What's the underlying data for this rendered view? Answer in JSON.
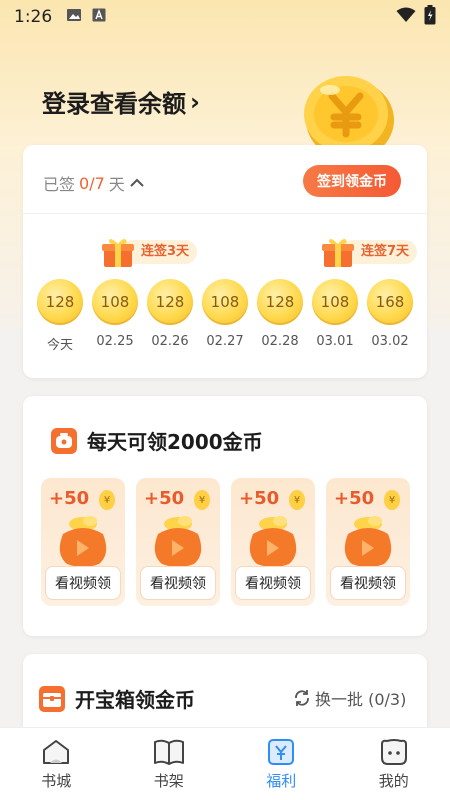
{
  "status_bar": {
    "time": "1:26",
    "icons": [
      "image-icon",
      "a-icon",
      "wifi-icon",
      "battery-icon"
    ]
  },
  "header": {
    "login_text": "登录查看余额",
    "chevron": "›"
  },
  "signin": {
    "signed_prefix": "已签",
    "signed_count": "0/7",
    "signed_suffix": "天",
    "button_label": "签到领金币",
    "badges": [
      {
        "label": "连签3天"
      },
      {
        "label": "连签7天"
      }
    ],
    "days": [
      {
        "coins": "128",
        "label": "今天"
      },
      {
        "coins": "108",
        "label": "02.25"
      },
      {
        "coins": "128",
        "label": "02.26"
      },
      {
        "coins": "108",
        "label": "02.27"
      },
      {
        "coins": "128",
        "label": "02.28"
      },
      {
        "coins": "108",
        "label": "03.01"
      },
      {
        "coins": "168",
        "label": "03.02"
      }
    ]
  },
  "video_task": {
    "title": "每天可领2000金币",
    "tiles": [
      {
        "reward": "+50",
        "action": "看视频领"
      },
      {
        "reward": "+50",
        "action": "看视频领"
      },
      {
        "reward": "+50",
        "action": "看视频领"
      },
      {
        "reward": "+50",
        "action": "看视频领"
      }
    ],
    "coin_symbol": "¥"
  },
  "treasure": {
    "title": "开宝箱领金币",
    "refresh_label": "换一批 (0/3)"
  },
  "tabs": [
    {
      "label": "书城",
      "icon": "home-icon",
      "active": false
    },
    {
      "label": "书架",
      "icon": "book-icon",
      "active": false
    },
    {
      "label": "福利",
      "icon": "yen-icon",
      "active": true
    },
    {
      "label": "我的",
      "icon": "user-icon",
      "active": false
    }
  ],
  "colors": {
    "accent": "#f55a34",
    "tab_active": "#2e8ef3",
    "coin": "#ffd94d"
  }
}
